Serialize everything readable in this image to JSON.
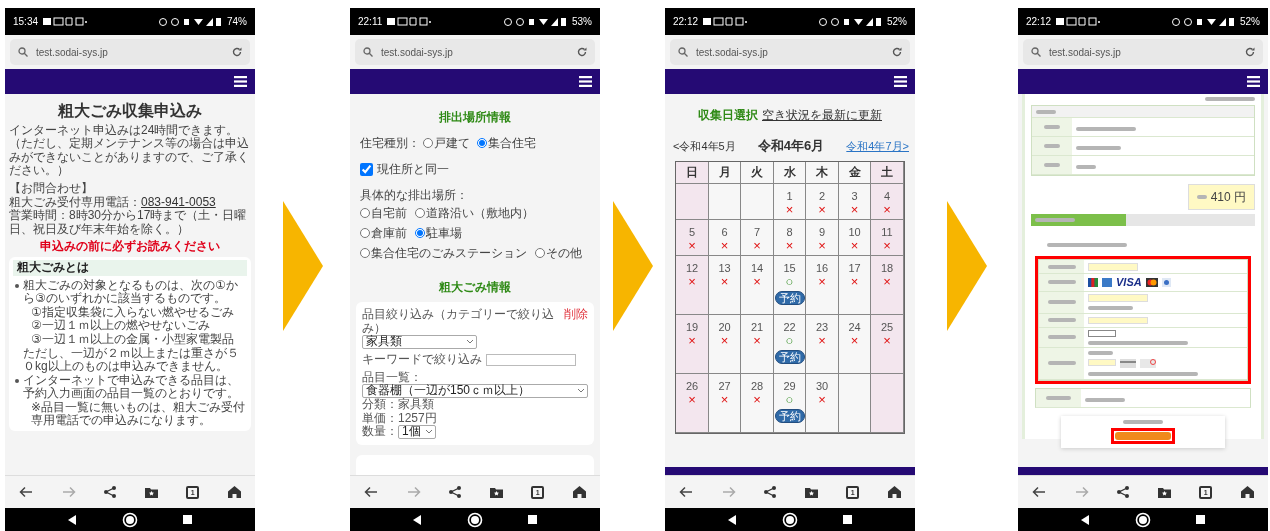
{
  "phones": [
    {
      "kind": "intro",
      "status": {
        "time": "15:34",
        "battery": "74%"
      },
      "url": "test.sodai-sys.jp",
      "tab_count": "1",
      "content": {
        "title": "粗大ごみ収集申込み",
        "intro": "インターネット申込みは24時間できます。（ただし、定期メンテナンス等の場合は申込みができないことがありますので、ご了承ください。）",
        "contact_heading": "【お問合わせ】",
        "phone_label": "粗大ごみ受付専用電話：",
        "phone_number": "083-941-0053",
        "hours": "営業時間：8時30分から17時まで（土・日曜日、祝日及び年末年始を除く。）",
        "notice": "申込みの前に必ずお読みください",
        "section_title": "粗大ごみとは",
        "bullets": [
          {
            "lines": [
              {
                "kind": "text",
                "text": "粗大ごみの対象となるものは、次の①から③のいずれかに該当するものです。"
              },
              {
                "kind": "note",
                "text": "①指定収集袋に入らない燃やせるごみ"
              },
              {
                "kind": "note",
                "text": "②一辺１ｍ以上の燃やせないごみ"
              },
              {
                "kind": "note",
                "text": "③一辺１ｍ以上の金属・小型家電製品"
              },
              {
                "kind": "text",
                "text": "ただし、一辺が２ｍ以上または重さが５０kg以上のものは申込みできません。"
              }
            ]
          },
          {
            "lines": [
              {
                "kind": "text",
                "text": "インターネットで申込みできる品目は、予約入力画面の品目一覧のとおりです。"
              },
              {
                "kind": "note",
                "text": "※品目一覧に無いものは、粗大ごみ受付専用電話での申込みになります。"
              }
            ]
          }
        ]
      }
    },
    {
      "kind": "place",
      "status": {
        "time": "22:11",
        "battery": "53%"
      },
      "url": "test.sodai-sys.jp",
      "tab_count": "1",
      "content": {
        "location_title": "排出場所情報",
        "housing_label": "住宅種別：",
        "housing_options": [
          {
            "label": "戸建て",
            "selected": false
          },
          {
            "label": "集合住宅",
            "selected": true
          }
        ],
        "same_address": {
          "label": "現住所と同一",
          "checked": true
        },
        "place_label": "具体的な排出場所：",
        "place_options": [
          {
            "label": "自宅前",
            "selected": false
          },
          {
            "label": "道路沿い（敷地内）",
            "selected": false
          },
          {
            "label": "倉庫前",
            "selected": false
          },
          {
            "label": "駐車場",
            "selected": true
          },
          {
            "label": "集合住宅のごみステーション",
            "selected": false
          },
          {
            "label": "その他",
            "selected": false
          }
        ],
        "items_title": "粗大ごみ情報",
        "item": {
          "filter_label": "品目絞り込み（カテゴリーで絞り込み）",
          "delete": "削除",
          "category": "家具類",
          "keyword_label": "キーワードで絞り込み",
          "list_label": "品目一覧：",
          "item_value": "食器棚（一辺が150ｃｍ以上）",
          "class_text": "分類：家具類",
          "price_text": "単価：1257円",
          "qty_label": "数量：",
          "qty_value": "1個"
        }
      }
    },
    {
      "kind": "calendar",
      "status": {
        "time": "22:12",
        "battery": "52%"
      },
      "url": "test.sodai-sys.jp",
      "tab_count": "1",
      "content": {
        "title": "収集日選択",
        "refresh_link": "空き状況を最新に更新",
        "prev_month": "<令和4年5月",
        "month": "令和4年6月",
        "next_month": "令和4年7月>",
        "weekdays": [
          "日",
          "月",
          "火",
          "水",
          "木",
          "金",
          "土"
        ],
        "weeks": [
          [
            {
              "kind": "blank"
            },
            {
              "kind": "blank"
            },
            {
              "kind": "blank"
            },
            {
              "day": "1",
              "mark": "×",
              "available": false
            },
            {
              "day": "2",
              "mark": "×",
              "available": false
            },
            {
              "day": "3",
              "mark": "×",
              "available": false
            },
            {
              "day": "4",
              "mark": "×",
              "available": false
            }
          ],
          [
            {
              "day": "5",
              "mark": "×",
              "available": false
            },
            {
              "day": "6",
              "mark": "×",
              "available": false
            },
            {
              "day": "7",
              "mark": "×",
              "available": false
            },
            {
              "day": "8",
              "mark": "×",
              "available": false
            },
            {
              "day": "9",
              "mark": "×",
              "available": false
            },
            {
              "day": "10",
              "mark": "×",
              "available": false
            },
            {
              "day": "11",
              "mark": "×",
              "available": false
            }
          ],
          [
            {
              "day": "12",
              "mark": "×",
              "available": false
            },
            {
              "day": "13",
              "mark": "×",
              "available": false
            },
            {
              "day": "14",
              "mark": "×",
              "available": false
            },
            {
              "day": "15",
              "mark": "○",
              "available": true,
              "reserve": "予約"
            },
            {
              "day": "16",
              "mark": "×",
              "available": false
            },
            {
              "day": "17",
              "mark": "×",
              "available": false
            },
            {
              "day": "18",
              "mark": "×",
              "available": false
            }
          ],
          [
            {
              "day": "19",
              "mark": "×",
              "available": false
            },
            {
              "day": "20",
              "mark": "×",
              "available": false
            },
            {
              "day": "21",
              "mark": "×",
              "available": false
            },
            {
              "day": "22",
              "mark": "○",
              "available": true,
              "reserve": "予約"
            },
            {
              "day": "23",
              "mark": "×",
              "available": false
            },
            {
              "day": "24",
              "mark": "×",
              "available": false
            },
            {
              "day": "25",
              "mark": "×",
              "available": false
            }
          ],
          [
            {
              "day": "26",
              "mark": "×",
              "available": false
            },
            {
              "day": "27",
              "mark": "×",
              "available": false
            },
            {
              "day": "28",
              "mark": "×",
              "available": false
            },
            {
              "day": "29",
              "mark": "○",
              "available": true,
              "reserve": "予約"
            },
            {
              "day": "30",
              "mark": "×",
              "available": false
            },
            {
              "kind": "blank"
            },
            {
              "kind": "blank"
            }
          ]
        ]
      }
    },
    {
      "kind": "payment",
      "status": {
        "time": "22:12",
        "battery": "52%"
      },
      "url": "test.sodai-sys.jp",
      "tab_count": "1",
      "content": {
        "amount": "410 円",
        "card_logo": "VISA"
      }
    }
  ]
}
